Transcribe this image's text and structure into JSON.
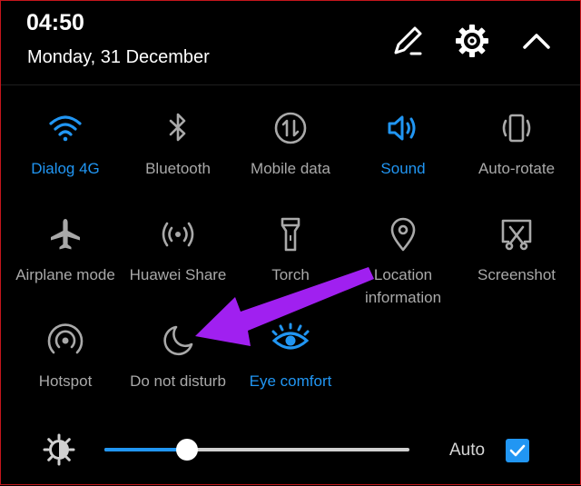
{
  "status": {
    "time": "04:50",
    "date": "Monday, 31 December"
  },
  "header_icons": [
    "edit-icon",
    "gear-icon",
    "chevron-up-icon"
  ],
  "tiles": [
    {
      "label": "Dialog 4G",
      "icon": "wifi-icon",
      "active": true
    },
    {
      "label": "Bluetooth",
      "icon": "bluetooth-icon",
      "active": false
    },
    {
      "label": "Mobile data",
      "icon": "mobile-data-icon",
      "active": false
    },
    {
      "label": "Sound",
      "icon": "speaker-icon",
      "active": true
    },
    {
      "label": "Auto-rotate",
      "icon": "auto-rotate-icon",
      "active": false
    },
    {
      "label": "Airplane mode",
      "icon": "airplane-icon",
      "active": false
    },
    {
      "label": "Huawei Share",
      "icon": "huawei-share-icon",
      "active": false
    },
    {
      "label": "Torch",
      "icon": "torch-icon",
      "active": false
    },
    {
      "label": "Location",
      "label2": "information",
      "icon": "location-pin-icon",
      "active": false
    },
    {
      "label": "Screenshot",
      "icon": "screenshot-icon",
      "active": false
    },
    {
      "label": "Hotspot",
      "icon": "hotspot-icon",
      "active": false
    },
    {
      "label": "Do not disturb",
      "icon": "moon-icon",
      "active": false
    },
    {
      "label": "Eye comfort",
      "icon": "eye-icon",
      "active": true
    }
  ],
  "brightness": {
    "level": 0.27,
    "auto_label": "Auto",
    "auto_checked": true
  },
  "colors": {
    "active": "#2196f3",
    "inactive": "#a9a9a9",
    "arrow": "#a020f0",
    "background": "#000000"
  }
}
